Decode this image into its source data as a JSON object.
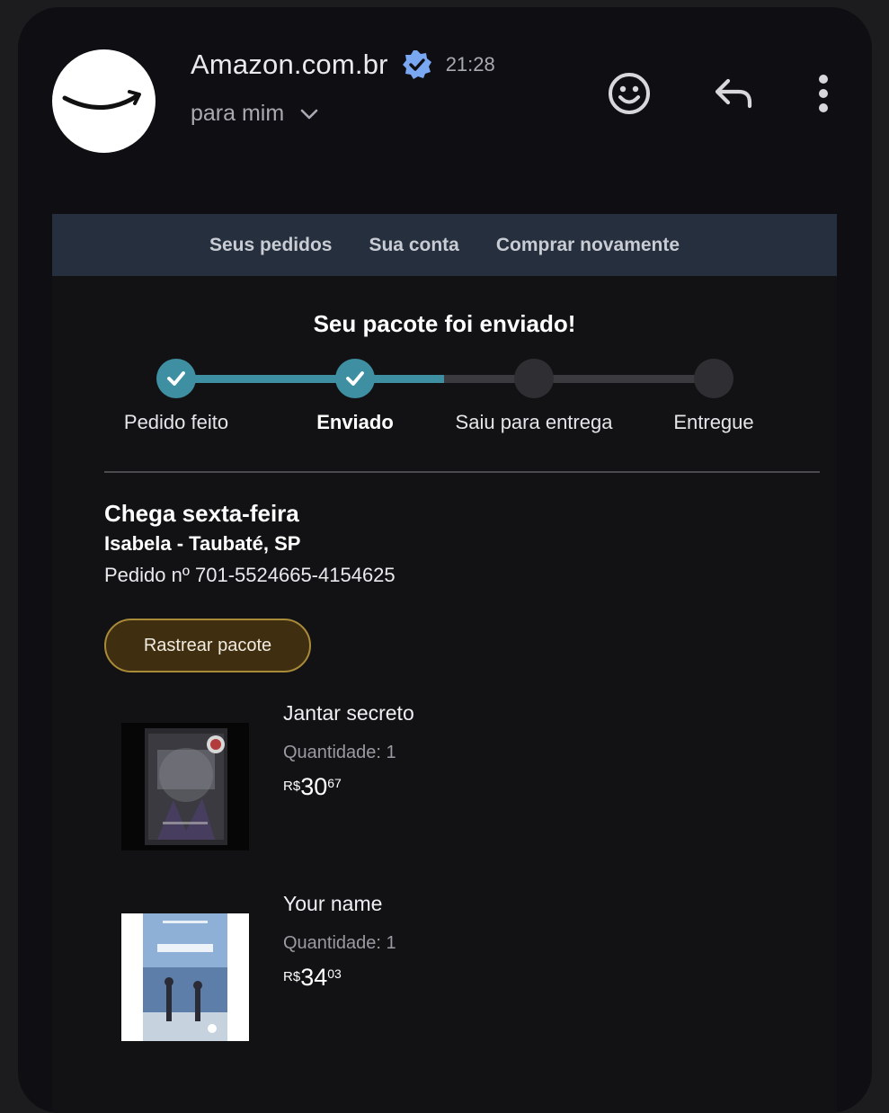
{
  "header": {
    "sender": "Amazon.com.br",
    "time": "21:28",
    "recipient": "para mim"
  },
  "nav": {
    "links": [
      "Seus pedidos",
      "Sua conta",
      "Comprar novamente"
    ]
  },
  "shipment": {
    "headline": "Seu pacote foi enviado!",
    "steps": [
      {
        "label": "Pedido feito",
        "status": "done"
      },
      {
        "label": "Enviado",
        "status": "done",
        "current": true
      },
      {
        "label": "Saiu para entrega",
        "status": "pending"
      },
      {
        "label": "Entregue",
        "status": "pending"
      }
    ],
    "progress_fraction": 0.5,
    "arrival": "Chega sexta-feira",
    "recipient_city": "Isabela - Taubaté, SP",
    "order_number": "Pedido nº 701-5524665-4154625",
    "track_button": "Rastrear pacote"
  },
  "items": [
    {
      "title": "Jantar secreto",
      "quantity": "Quantidade: 1",
      "price": {
        "currency": "R$",
        "whole": "30",
        "cents": "67"
      }
    },
    {
      "title": "Your name",
      "quantity": "Quantidade: 1",
      "price": {
        "currency": "R$",
        "whole": "34",
        "cents": "03"
      }
    }
  ],
  "colors": {
    "accent_teal": "#3f8fa3",
    "nav_bg": "#252f3e",
    "button_bg": "#3f2e10",
    "button_border": "#a88a39",
    "verified_badge": "#7aa7f2"
  },
  "icons": [
    "amazon-smile-logo",
    "verified-icon",
    "chevron-down-icon",
    "emoji-icon",
    "reply-icon",
    "more-vert-icon",
    "check-icon"
  ]
}
